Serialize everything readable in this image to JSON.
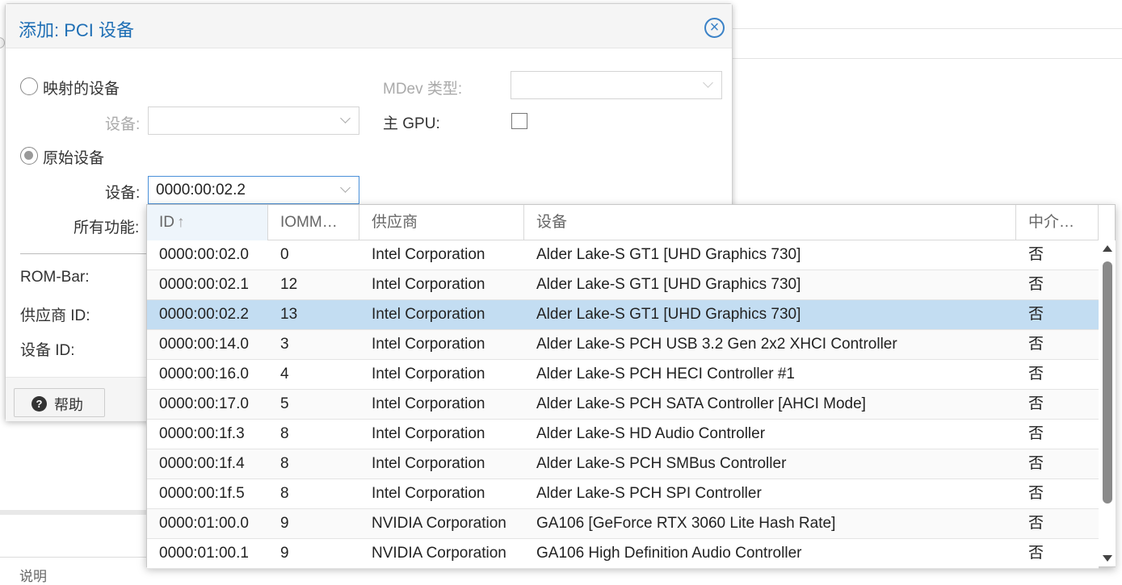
{
  "dialog": {
    "title": "添加: PCI 设备",
    "mapped_device_label": "映射的设备",
    "device_label": "设备:",
    "raw_device_label": "原始设备",
    "raw_device_field_label": "设备:",
    "raw_device_value": "0000:00:02.2",
    "all_functions_label": "所有功能:",
    "mdev_type_label": "MDev 类型:",
    "primary_gpu_label": "主 GPU:",
    "rombar_label": "ROM-Bar:",
    "vendor_id_label": "供应商 ID:",
    "device_id_label": "设备 ID:",
    "help_label": "帮助",
    "raw_device_selected": true,
    "mapped_device_selected": false,
    "primary_gpu_checked": false
  },
  "background": {
    "description_label": "说明"
  },
  "grid": {
    "columns": [
      "ID",
      "IOMM…",
      "供应商",
      "设备",
      "中介…"
    ],
    "sort_column": "ID",
    "sort_direction": "ascending",
    "selected_id": "0000:00:02.2",
    "rows": [
      {
        "id": "0000:00:02.0",
        "iommu": "0",
        "vendor": "Intel Corporation",
        "device": "Alder Lake-S GT1 [UHD Graphics 730]",
        "mdev": "否"
      },
      {
        "id": "0000:00:02.1",
        "iommu": "12",
        "vendor": "Intel Corporation",
        "device": "Alder Lake-S GT1 [UHD Graphics 730]",
        "mdev": "否"
      },
      {
        "id": "0000:00:02.2",
        "iommu": "13",
        "vendor": "Intel Corporation",
        "device": "Alder Lake-S GT1 [UHD Graphics 730]",
        "mdev": "否"
      },
      {
        "id": "0000:00:14.0",
        "iommu": "3",
        "vendor": "Intel Corporation",
        "device": "Alder Lake-S PCH USB 3.2 Gen 2x2 XHCI Controller",
        "mdev": "否"
      },
      {
        "id": "0000:00:16.0",
        "iommu": "4",
        "vendor": "Intel Corporation",
        "device": "Alder Lake-S PCH HECI Controller #1",
        "mdev": "否"
      },
      {
        "id": "0000:00:17.0",
        "iommu": "5",
        "vendor": "Intel Corporation",
        "device": "Alder Lake-S PCH SATA Controller [AHCI Mode]",
        "mdev": "否"
      },
      {
        "id": "0000:00:1f.3",
        "iommu": "8",
        "vendor": "Intel Corporation",
        "device": "Alder Lake-S HD Audio Controller",
        "mdev": "否"
      },
      {
        "id": "0000:00:1f.4",
        "iommu": "8",
        "vendor": "Intel Corporation",
        "device": "Alder Lake-S PCH SMBus Controller",
        "mdev": "否"
      },
      {
        "id": "0000:00:1f.5",
        "iommu": "8",
        "vendor": "Intel Corporation",
        "device": "Alder Lake-S PCH SPI Controller",
        "mdev": "否"
      },
      {
        "id": "0000:01:00.0",
        "iommu": "9",
        "vendor": "NVIDIA Corporation",
        "device": "GA106 [GeForce RTX 3060 Lite Hash Rate]",
        "mdev": "否"
      },
      {
        "id": "0000:01:00.1",
        "iommu": "9",
        "vendor": "NVIDIA Corporation",
        "device": "GA106 High Definition Audio Controller",
        "mdev": "否"
      }
    ]
  },
  "colors": {
    "accent": "#1f6fb5",
    "selected_row": "#c3ddf2"
  }
}
